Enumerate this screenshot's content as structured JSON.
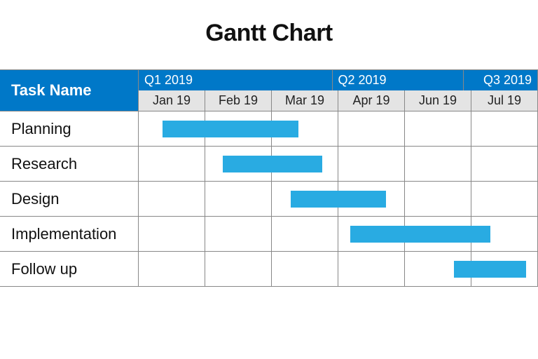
{
  "title": "Gantt Chart",
  "header": {
    "task_label": "Task Name",
    "quarters": [
      "Q1 2019",
      "Q2 2019",
      "Q3 2019"
    ],
    "months": [
      "Jan 19",
      "Feb 19",
      "Mar 19",
      "Apr 19",
      "Jun 19",
      "Jul 19"
    ]
  },
  "tasks": [
    {
      "name": "Planning"
    },
    {
      "name": "Research"
    },
    {
      "name": "Design"
    },
    {
      "name": "Implementation"
    },
    {
      "name": "Follow up"
    }
  ],
  "bars": [
    {
      "left_pct": 6,
      "width_pct": 34
    },
    {
      "left_pct": 21,
      "width_pct": 25
    },
    {
      "left_pct": 38,
      "width_pct": 24
    },
    {
      "left_pct": 53,
      "width_pct": 35
    },
    {
      "left_pct": 79,
      "width_pct": 18
    }
  ],
  "colors": {
    "header_blue": "#0078c8",
    "bar_blue": "#29abe2",
    "month_bg": "#e4e4e4"
  },
  "chart_data": {
    "type": "gantt",
    "title": "Gantt Chart",
    "time_axis": {
      "months": [
        "Jan 19",
        "Feb 19",
        "Mar 19",
        "Apr 19",
        "Jun 19",
        "Jul 19"
      ],
      "quarters": [
        {
          "label": "Q1 2019",
          "months": [
            "Jan 19",
            "Feb 19",
            "Mar 19"
          ]
        },
        {
          "label": "Q2 2019",
          "months": [
            "Apr 19",
            "Jun 19"
          ]
        },
        {
          "label": "Q3 2019",
          "months": [
            "Jul 19"
          ]
        }
      ]
    },
    "tasks": [
      {
        "name": "Planning",
        "start": "mid Jan 19",
        "end": "mid Mar 19",
        "start_month_index": 0.35,
        "end_month_index": 2.4
      },
      {
        "name": "Research",
        "start": "early Feb 19",
        "end": "late Mar 19",
        "start_month_index": 1.25,
        "end_month_index": 2.75
      },
      {
        "name": "Design",
        "start": "early Mar 19",
        "end": "mid Apr 19",
        "start_month_index": 2.3,
        "end_month_index": 3.7
      },
      {
        "name": "Implementation",
        "start": "early Apr 19",
        "end": "early Jul 19",
        "start_month_index": 3.2,
        "end_month_index": 5.25
      },
      {
        "name": "Follow up",
        "start": "late Jun 19",
        "end": "late Jul 19",
        "start_month_index": 4.75,
        "end_month_index": 5.85
      }
    ]
  }
}
